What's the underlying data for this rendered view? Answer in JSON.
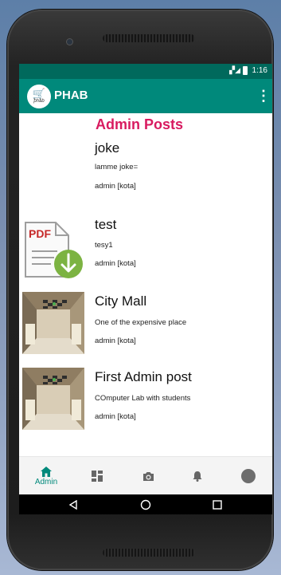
{
  "status_bar": {
    "time": "1:16"
  },
  "app_bar": {
    "logo_text": "phab",
    "title": "PHAB"
  },
  "page": {
    "heading": "Admin Posts"
  },
  "posts": [
    {
      "title": "joke",
      "description": "lamme joke=",
      "author": "admin [kota]",
      "thumbnail": "none"
    },
    {
      "title": "test",
      "description": "tesy1",
      "author": "admin [kota]",
      "thumbnail": "pdf-download-icon",
      "thumb_label": "PDF"
    },
    {
      "title": "City Mall",
      "description": "One of the expensive place",
      "author": "admin [kota]",
      "thumbnail": "photo"
    },
    {
      "title": "First Admin post",
      "description": "COmputer Lab with students",
      "author": "admin [kota]",
      "thumbnail": "photo"
    }
  ],
  "bottom_nav": [
    {
      "icon": "home-icon",
      "label": "Admin",
      "active": true
    },
    {
      "icon": "dashboard-icon",
      "label": ""
    },
    {
      "icon": "camera-icon",
      "label": ""
    },
    {
      "icon": "bell-icon",
      "label": ""
    },
    {
      "icon": "profile-circle-icon",
      "label": ""
    }
  ],
  "colors": {
    "primary": "#00897b",
    "primary_dark": "#00695c",
    "accent": "#d81b60"
  }
}
